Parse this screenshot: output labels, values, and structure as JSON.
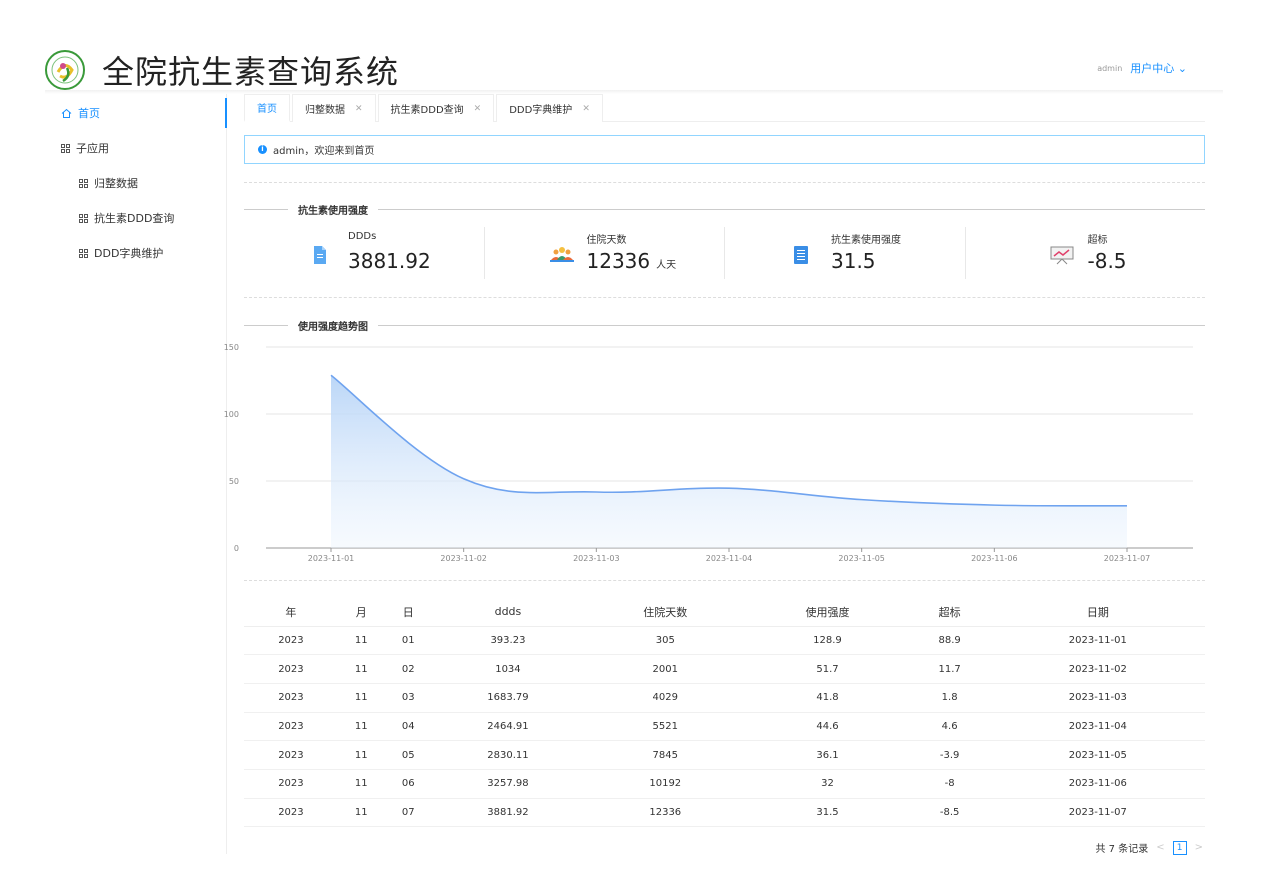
{
  "app": {
    "title": "全院抗生素查询系统"
  },
  "user": {
    "name": "admin",
    "menu_label": "用户中心"
  },
  "sidebar": {
    "items": [
      {
        "label": "首页",
        "active": true
      },
      {
        "label": "子应用"
      },
      {
        "label": "归整数据"
      },
      {
        "label": "抗生素DDD查询"
      },
      {
        "label": "DDD字典维护"
      }
    ]
  },
  "tabs": [
    {
      "label": "首页",
      "active": true,
      "closable": false
    },
    {
      "label": "归整数据",
      "closable": true
    },
    {
      "label": "抗生素DDD查询",
      "closable": true
    },
    {
      "label": "DDD字典维护",
      "closable": true
    }
  ],
  "alert": {
    "text": "admin，欢迎来到首页"
  },
  "stats_section": {
    "title": "抗生素使用强度"
  },
  "stats": [
    {
      "label": "DDDs",
      "value": "3881.92",
      "unit": "",
      "icon": "document-icon",
      "color": "#5aa9f2"
    },
    {
      "label": "住院天数",
      "value": "12336",
      "unit": "人天",
      "icon": "people-icon",
      "color": "#f0a040"
    },
    {
      "label": "抗生素使用强度",
      "value": "31.5",
      "unit": "",
      "icon": "list-book-icon",
      "color": "#3a8ee6"
    },
    {
      "label": "超标",
      "value": "-8.5",
      "unit": "",
      "icon": "presentation-chart-icon",
      "color": "#e0416b"
    }
  ],
  "chart_section": {
    "title": "使用强度趋势图"
  },
  "chart_data": {
    "type": "area",
    "title": "使用强度趋势图",
    "x": [
      "2023-11-01",
      "2023-11-02",
      "2023-11-03",
      "2023-11-04",
      "2023-11-05",
      "2023-11-06",
      "2023-11-07"
    ],
    "series": [
      {
        "values": [
          128.9,
          51.7,
          41.8,
          44.6,
          36.1,
          32,
          31.5
        ]
      }
    ],
    "ylim": [
      0,
      150
    ],
    "yticks": [
      0,
      50,
      100,
      150
    ],
    "grid": true,
    "color": "#6fa3ef"
  },
  "table": {
    "headers": [
      "年",
      "月",
      "日",
      "ddds",
      "住院天数",
      "使用强度",
      "超标",
      "日期"
    ],
    "rows": [
      [
        "2023",
        "11",
        "01",
        "393.23",
        "305",
        "128.9",
        "88.9",
        "2023-11-01"
      ],
      [
        "2023",
        "11",
        "02",
        "1034",
        "2001",
        "51.7",
        "11.7",
        "2023-11-02"
      ],
      [
        "2023",
        "11",
        "03",
        "1683.79",
        "4029",
        "41.8",
        "1.8",
        "2023-11-03"
      ],
      [
        "2023",
        "11",
        "04",
        "2464.91",
        "5521",
        "44.6",
        "4.6",
        "2023-11-04"
      ],
      [
        "2023",
        "11",
        "05",
        "2830.11",
        "7845",
        "36.1",
        "-3.9",
        "2023-11-05"
      ],
      [
        "2023",
        "11",
        "06",
        "3257.98",
        "10192",
        "32",
        "-8",
        "2023-11-06"
      ],
      [
        "2023",
        "11",
        "07",
        "3881.92",
        "12336",
        "31.5",
        "-8.5",
        "2023-11-07"
      ]
    ]
  },
  "pagination": {
    "total_text": "共 7 条记录",
    "current_page": "1"
  }
}
